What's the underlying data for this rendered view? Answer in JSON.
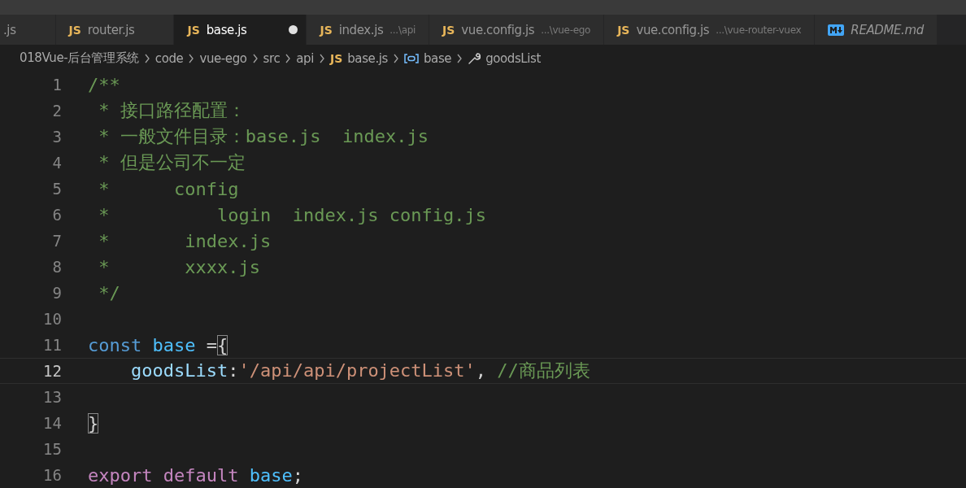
{
  "tabs": [
    {
      "label": ".js",
      "kind": "clipped",
      "selected": false,
      "dirty": false,
      "preview": false
    },
    {
      "label": "router.js",
      "kind": "script",
      "badge": "JS",
      "selected": false,
      "dirty": false,
      "preview": false
    },
    {
      "label": "base.js",
      "kind": "script",
      "badge": "JS",
      "selected": true,
      "dirty": true,
      "preview": false
    },
    {
      "label": "index.js",
      "path": "...\\api",
      "kind": "script",
      "badge": "JS",
      "selected": false,
      "dirty": false,
      "preview": false
    },
    {
      "label": "vue.config.js",
      "path": "...\\vue-ego",
      "kind": "script",
      "badge": "JS",
      "selected": false,
      "dirty": false,
      "preview": false
    },
    {
      "label": "vue.config.js",
      "path": "...\\vue-router-vuex",
      "kind": "script",
      "badge": "JS",
      "selected": false,
      "dirty": false,
      "preview": false
    },
    {
      "label": "README.md",
      "kind": "markdown",
      "selected": false,
      "dirty": false,
      "preview": true
    }
  ],
  "breadcrumb": [
    {
      "label": "018Vue-后台管理系统",
      "kind": "folder"
    },
    {
      "label": "code",
      "kind": "folder"
    },
    {
      "label": "vue-ego",
      "kind": "folder"
    },
    {
      "label": "src",
      "kind": "folder"
    },
    {
      "label": "api",
      "kind": "folder"
    },
    {
      "label": "base.js",
      "kind": "file",
      "badge": "JS"
    },
    {
      "label": "base",
      "kind": "variable"
    },
    {
      "label": "goodsList",
      "kind": "property"
    }
  ],
  "editor": {
    "lines": [
      {
        "number": "1",
        "current": false,
        "tokens": [
          {
            "kind": "comment",
            "text": "/**"
          }
        ]
      },
      {
        "number": "2",
        "current": false,
        "tokens": [
          {
            "kind": "comment",
            "text": " * 接口路径配置："
          }
        ]
      },
      {
        "number": "3",
        "current": false,
        "tokens": [
          {
            "kind": "comment",
            "text": " * 一般文件目录：base.js  index.js"
          }
        ]
      },
      {
        "number": "4",
        "current": false,
        "tokens": [
          {
            "kind": "comment",
            "text": " * 但是公司不一定"
          }
        ]
      },
      {
        "number": "5",
        "current": false,
        "tokens": [
          {
            "kind": "comment",
            "text": " *      config"
          }
        ]
      },
      {
        "number": "6",
        "current": false,
        "tokens": [
          {
            "kind": "comment",
            "text": " *          login  index.js config.js"
          }
        ]
      },
      {
        "number": "7",
        "current": false,
        "tokens": [
          {
            "kind": "comment",
            "text": " *       index.js"
          }
        ]
      },
      {
        "number": "8",
        "current": false,
        "tokens": [
          {
            "kind": "comment",
            "text": " *       xxxx.js"
          }
        ]
      },
      {
        "number": "9",
        "current": false,
        "tokens": [
          {
            "kind": "comment",
            "text": " */"
          }
        ]
      },
      {
        "number": "10",
        "current": false
      },
      {
        "number": "11",
        "current": false,
        "tokens": [
          {
            "kind": "keyword",
            "text": "const "
          },
          {
            "kind": "variable",
            "text": "base"
          },
          {
            "kind": "plain",
            "text": " ="
          },
          {
            "kind": "bracket",
            "text": "{"
          }
        ]
      },
      {
        "number": "12",
        "current": true,
        "tokens": [
          {
            "kind": "property",
            "text": "    goodsList"
          },
          {
            "kind": "plain",
            "text": ":"
          },
          {
            "kind": "string",
            "text": "'/api/api/projectList'"
          },
          {
            "kind": "plain",
            "text": ", "
          },
          {
            "kind": "comment",
            "text": "//商品列表"
          }
        ]
      },
      {
        "number": "13",
        "current": false
      },
      {
        "number": "14",
        "current": false,
        "tokens": [
          {
            "kind": "bracket",
            "text": "}"
          }
        ]
      },
      {
        "number": "15",
        "current": false
      },
      {
        "number": "16",
        "current": false,
        "tokens": [
          {
            "kind": "control",
            "text": "export default "
          },
          {
            "kind": "variable",
            "text": "base"
          },
          {
            "kind": "plain",
            "text": ";"
          }
        ]
      }
    ]
  }
}
